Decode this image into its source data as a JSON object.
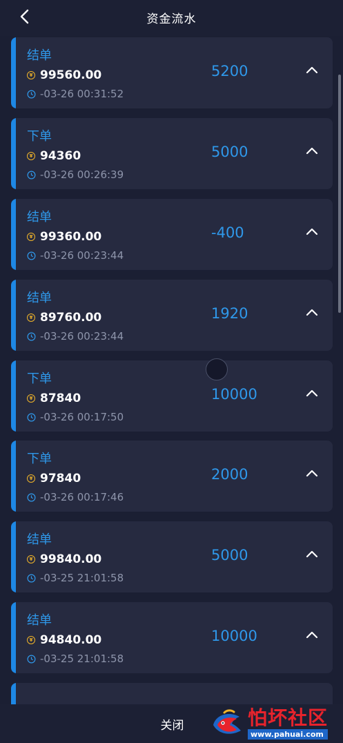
{
  "header": {
    "title": "资金流水"
  },
  "records": [
    {
      "type": "结单",
      "balance": "99560.00",
      "time": "-03-26 00:31:52",
      "amount": "5200"
    },
    {
      "type": "下单",
      "balance": "94360",
      "time": "-03-26 00:26:39",
      "amount": "5000"
    },
    {
      "type": "结单",
      "balance": "99360.00",
      "time": "-03-26 00:23:44",
      "amount": "-400"
    },
    {
      "type": "结单",
      "balance": "89760.00",
      "time": "-03-26 00:23:44",
      "amount": "1920"
    },
    {
      "type": "下单",
      "balance": "87840",
      "time": "-03-26 00:17:50",
      "amount": "10000"
    },
    {
      "type": "下单",
      "balance": "97840",
      "time": "-03-26 00:17:46",
      "amount": "2000"
    },
    {
      "type": "结单",
      "balance": "99840.00",
      "time": "-03-25 21:01:58",
      "amount": "5000"
    },
    {
      "type": "结单",
      "balance": "94840.00",
      "time": "-03-25 21:01:58",
      "amount": "10000"
    }
  ],
  "footer": {
    "close_label": "关闭"
  },
  "watermark": {
    "text": "怕坏社区",
    "url": "www.pahuai.com"
  },
  "colors": {
    "accent": "#2f98ea",
    "bar": "#1e88e5",
    "card": "#262a40",
    "background": "#1b1f33",
    "coin": "#f0b429"
  },
  "icons": {
    "back": "chevron-left-icon",
    "coin": "coin-icon",
    "clock": "clock-icon",
    "expand": "chevron-up-icon"
  }
}
